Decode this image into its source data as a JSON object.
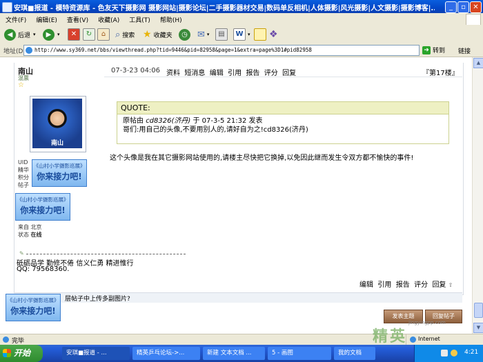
{
  "window": {
    "title": "安琪■报道 - 模特资源库 - 色友天下摄影网 摄影网站|摄影论坛|二手摄影器材交易|数码单反相机|人体摄影|风光摄影|人文摄影|摄影博客|..."
  },
  "menu": [
    "文件(F)",
    "编辑(E)",
    "查看(V)",
    "收藏(A)",
    "工具(T)",
    "帮助(H)"
  ],
  "toolbar": {
    "back": "后退",
    "search": "搜索",
    "favorites": "收藏夹"
  },
  "address": {
    "label": "地址(D)",
    "url": "http://www.sy369.net/bbs/viewthread.php?tid=9446&pid=82958&page=1&extra=page%3D1#pid82958",
    "go": "转到",
    "links": "链接"
  },
  "post": {
    "author": "南山",
    "author_rank": "混票",
    "date": "07-3-23 04:06",
    "actions": [
      "资料",
      "短消息",
      "编辑",
      "引用",
      "报告",
      "评分",
      "回复"
    ],
    "floor": "『第17楼』",
    "avatar_caption": "南山",
    "profile_items": [
      "UID",
      "精华",
      "积分",
      "帖子"
    ],
    "from_label": "来自",
    "from_value": "北京",
    "status_label": "状态",
    "status_value": "在线",
    "quote_header": "QUOTE:",
    "quote_line1_a": "原帖由",
    "quote_line1_user": "cd8326(济丹)",
    "quote_line1_b": "于 07-3-5 21:32 发表",
    "quote_line2": "哥们:用自己的头像,不要用别人的,请好自为之!cd8326(济丹)",
    "message": "这个头像是我在其它摄影网站使用的,请楼主尽快把它换掉,以免因此继而发生令双方都不愉快的事件!",
    "signature_1": "砥砺品学 勤修不倦 信义仁勇 精进惟行",
    "signature_2": "QQ: 79568360.",
    "bottom_actions": [
      "编辑",
      "引用",
      "报告",
      "评分",
      "回复"
    ],
    "upload_hint": "层帖子中上传多副图片?"
  },
  "banner": {
    "line1": "《山村小学摄影巡展》",
    "line2": "你来接力吧!"
  },
  "buttons": {
    "new_thread": "发表主题",
    "reply": "回复帖子"
  },
  "status": {
    "text": "完毕",
    "zone": "Internet"
  },
  "taskbar": {
    "start": "开始",
    "tasks": [
      "安琪■报道 - ...",
      "精英乒乓论坛->...",
      "新建 文本文档 ...",
      "5 - 画图",
      "我的文档"
    ],
    "clock": "4:21"
  },
  "watermark": {
    "cn": "精英",
    "en": "jingyingpp.com"
  }
}
